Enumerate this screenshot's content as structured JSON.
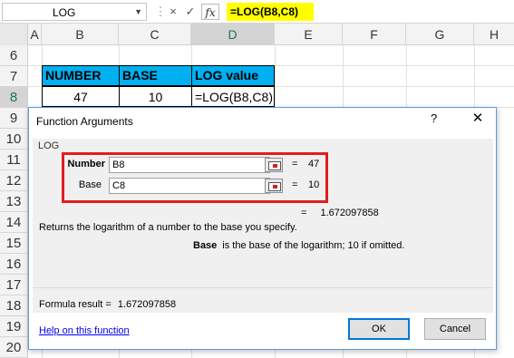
{
  "formula_bar": {
    "name_box": "LOG",
    "cancel_icon": "×",
    "enter_icon": "✓",
    "fx_label": "fx",
    "formula": "=LOG(B8,C8)"
  },
  "sheet": {
    "columns": [
      "A",
      "B",
      "C",
      "D",
      "E",
      "F",
      "G",
      "H"
    ],
    "rows": [
      "6",
      "7",
      "8",
      "9",
      "10",
      "11",
      "12",
      "13",
      "14",
      "15",
      "16",
      "17",
      "18",
      "19",
      "20"
    ],
    "header_row": {
      "number": "NUMBER",
      "base": "BASE",
      "log_value": "LOG value"
    },
    "data_row": {
      "number": "47",
      "base": "10",
      "log_formula": "=LOG(B8,C8)"
    },
    "colors": {
      "header_fill": "#00b0f0",
      "formula_highlight": "#ffff00",
      "highlight_box": "#e01e1e"
    }
  },
  "dialog": {
    "title": "Function Arguments",
    "help_icon": "?",
    "close_icon": "✕",
    "function_name": "LOG",
    "args": [
      {
        "label": "Number",
        "value": "B8",
        "result": "47"
      },
      {
        "label": "Base",
        "value": "C8",
        "result": "10"
      }
    ],
    "equals": "=",
    "overall_result": "1.672097858",
    "description": "Returns the logarithm of a number to the base you specify.",
    "arg_name": "Base",
    "arg_help": "is the base of the logarithm; 10 if omitted.",
    "formula_result_label": "Formula result =",
    "formula_result_value": "1.672097858",
    "help_link": "Help on this function",
    "ok_label": "OK",
    "cancel_label": "Cancel"
  }
}
